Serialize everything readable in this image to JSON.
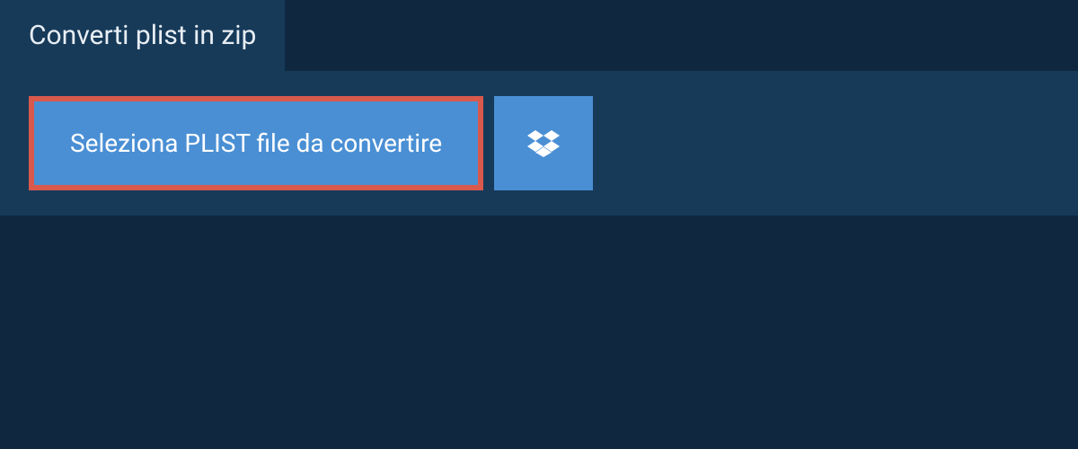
{
  "tab": {
    "title": "Converti plist in zip"
  },
  "buttons": {
    "select_file_label": "Seleziona PLIST file da convertire"
  },
  "colors": {
    "background": "#0f2840",
    "panel": "#173a59",
    "button_bg": "#4a8fd4",
    "button_border": "#d9594d"
  }
}
